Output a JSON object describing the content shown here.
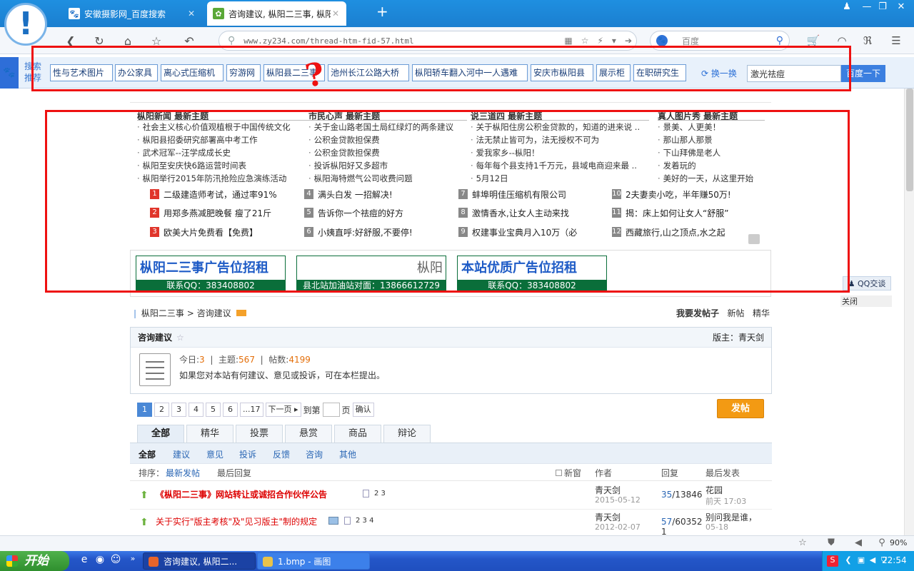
{
  "tabs": [
    {
      "label": "安徽摄影网_百度搜索",
      "active": false,
      "icon": "baidu-paw-icon"
    },
    {
      "label": "咨询建议, 枞阳二三事, 枞阳",
      "active": true,
      "icon": "forum-icon"
    }
  ],
  "nav": {
    "url": "www.zy234.com/thread-htm-fid-57.html",
    "search_engine": "百度"
  },
  "recommend": {
    "label": "搜索推荐",
    "chips": [
      "性与艺术图片",
      "办公家具",
      "离心式压缩机",
      "穷游网",
      "枞阳县二三事",
      "池州长江公路大桥",
      "枞阳轿车翻入河中一人遇难",
      "安庆市枞阳县",
      "展示柜",
      "在职研究生"
    ],
    "swap": "换一换",
    "input_value": "激光祛痘",
    "button": "百度一下"
  },
  "news": {
    "columns": [
      {
        "title": "枞阳新闻 最新主题",
        "items": [
          "社会主义核心价值观植根于中国传统文化",
          "枞阳县招委研究部署高中考工作",
          "武术冠军--汪学成成长史",
          "枞阳至安庆快6路运营时间表",
          "枞阳举行2015年防汛抢险应急演练活动"
        ]
      },
      {
        "title": "市民心声 最新主题",
        "items": [
          "关于金山路老国土局红绿灯的两条建议",
          "公积金贷款担保费",
          "公积金贷款担保费",
          "投诉枞阳好又多超市",
          "枞阳海特燃气公司收费问题"
        ]
      },
      {
        "title": "说三道四 最新主题",
        "items": [
          "关于枞阳住房公积金贷款的，知道的进来说 ..",
          "法无禁止皆可为，法无授权不可为",
          "爱我家乡--枞阳！",
          "每年每个县支持1千万元，县域电商迎来最 ..",
          "5月12日"
        ]
      },
      {
        "title": "真人图片秀 最新主题",
        "items": [
          "景美、人更美！",
          "那山那人那景",
          "下山拜佛是老人",
          "发着玩的",
          "美好的一天，从这里开始"
        ]
      }
    ],
    "ranked": [
      {
        "n": "1",
        "text": "二级建造师考试，通过率91%"
      },
      {
        "n": "2",
        "text": "用郑多燕减肥晚餐 瘦了21斤"
      },
      {
        "n": "3",
        "text": "欧美大片免费看【免费】"
      },
      {
        "n": "4",
        "text": "满头白发 一招解决!"
      },
      {
        "n": "5",
        "text": "告诉你一个祛痘的好方"
      },
      {
        "n": "6",
        "text": "小姨直呼:好舒服,不要停!"
      },
      {
        "n": "7",
        "text": "蚌埠明佳压缩机有限公司"
      },
      {
        "n": "8",
        "text": "激情香水,让女人主动来找"
      },
      {
        "n": "9",
        "text": "权建事业宝典月入10万（必"
      },
      {
        "n": "10",
        "text": "2夫妻卖小吃，半年赚50万!"
      },
      {
        "n": "11",
        "text": "揭：床上如何让女人“舒服”"
      },
      {
        "n": "12",
        "text": "西藏旅行,山之顶点,水之起"
      }
    ]
  },
  "ads": [
    {
      "headline": "枞阳二三事广告位招租",
      "contact": "联系QQ：383408802"
    },
    {
      "headline": "枞阳",
      "contact": "县北站加油站对面：13866612729"
    },
    {
      "headline": "本站优质广告位招租",
      "contact": "联系QQ：383408802"
    }
  ],
  "qq": {
    "label": "QQ交谈",
    "close": "关闭"
  },
  "breadcrumb": {
    "home": "枞阳二三事",
    "sep": " > ",
    "current": "咨询建议",
    "actions": [
      "我要发帖子",
      "新帖",
      "精华"
    ]
  },
  "board": {
    "title": "咨询建议",
    "moderator": "版主：青天剑",
    "today_label": "今日:",
    "today": "3",
    "topics_label": "主题:",
    "topics": "567",
    "posts_label": "帖数:",
    "posts": "4199",
    "description": "如果您对本站有何建议、意见或投诉，可在本栏提出。"
  },
  "pager": {
    "pages": [
      "1",
      "2",
      "3",
      "4",
      "5",
      "6",
      "...17"
    ],
    "next": "下一页",
    "goto": "到第",
    "page_unit": "页",
    "confirm": "确认"
  },
  "post_button": "发帖",
  "filter_tabs": [
    "全部",
    "精华",
    "投票",
    "悬赏",
    "商品",
    "辩论"
  ],
  "sub_tabs": [
    "全部",
    "建议",
    "意见",
    "投诉",
    "反馈",
    "咨询",
    "其他"
  ],
  "list_header": {
    "sort": "排序：",
    "newest": "最新发帖",
    "last_reply": "最后回复",
    "new_window": "新窗",
    "author": "作者",
    "replies": "回复",
    "last_post": "最后发表"
  },
  "threads": [
    {
      "title": "《枞阳二三事》网站转让或诚招合作伙伴公告",
      "pages": "2  3",
      "author": "青天剑",
      "date": "2015-05-12",
      "replies": "35",
      "views": "/13846",
      "last_user": "花园",
      "last_time": "前天 17:03"
    },
    {
      "title": "关于实行\"版主考核\"及\"见习版主\"制的规定",
      "pages": "2  3  4",
      "author": "青天剑",
      "date": "2012-02-07",
      "replies": "57",
      "views": "/60352",
      "views2": "1",
      "last_user": "别问我是谁，",
      "last_time": "05-18"
    }
  ],
  "status": {
    "zoom": "90%"
  },
  "taskbar": {
    "start": "开始",
    "tasks": [
      "咨询建议, 枞阳二...",
      "1.bmp - 画图"
    ],
    "clock": "22:54"
  }
}
